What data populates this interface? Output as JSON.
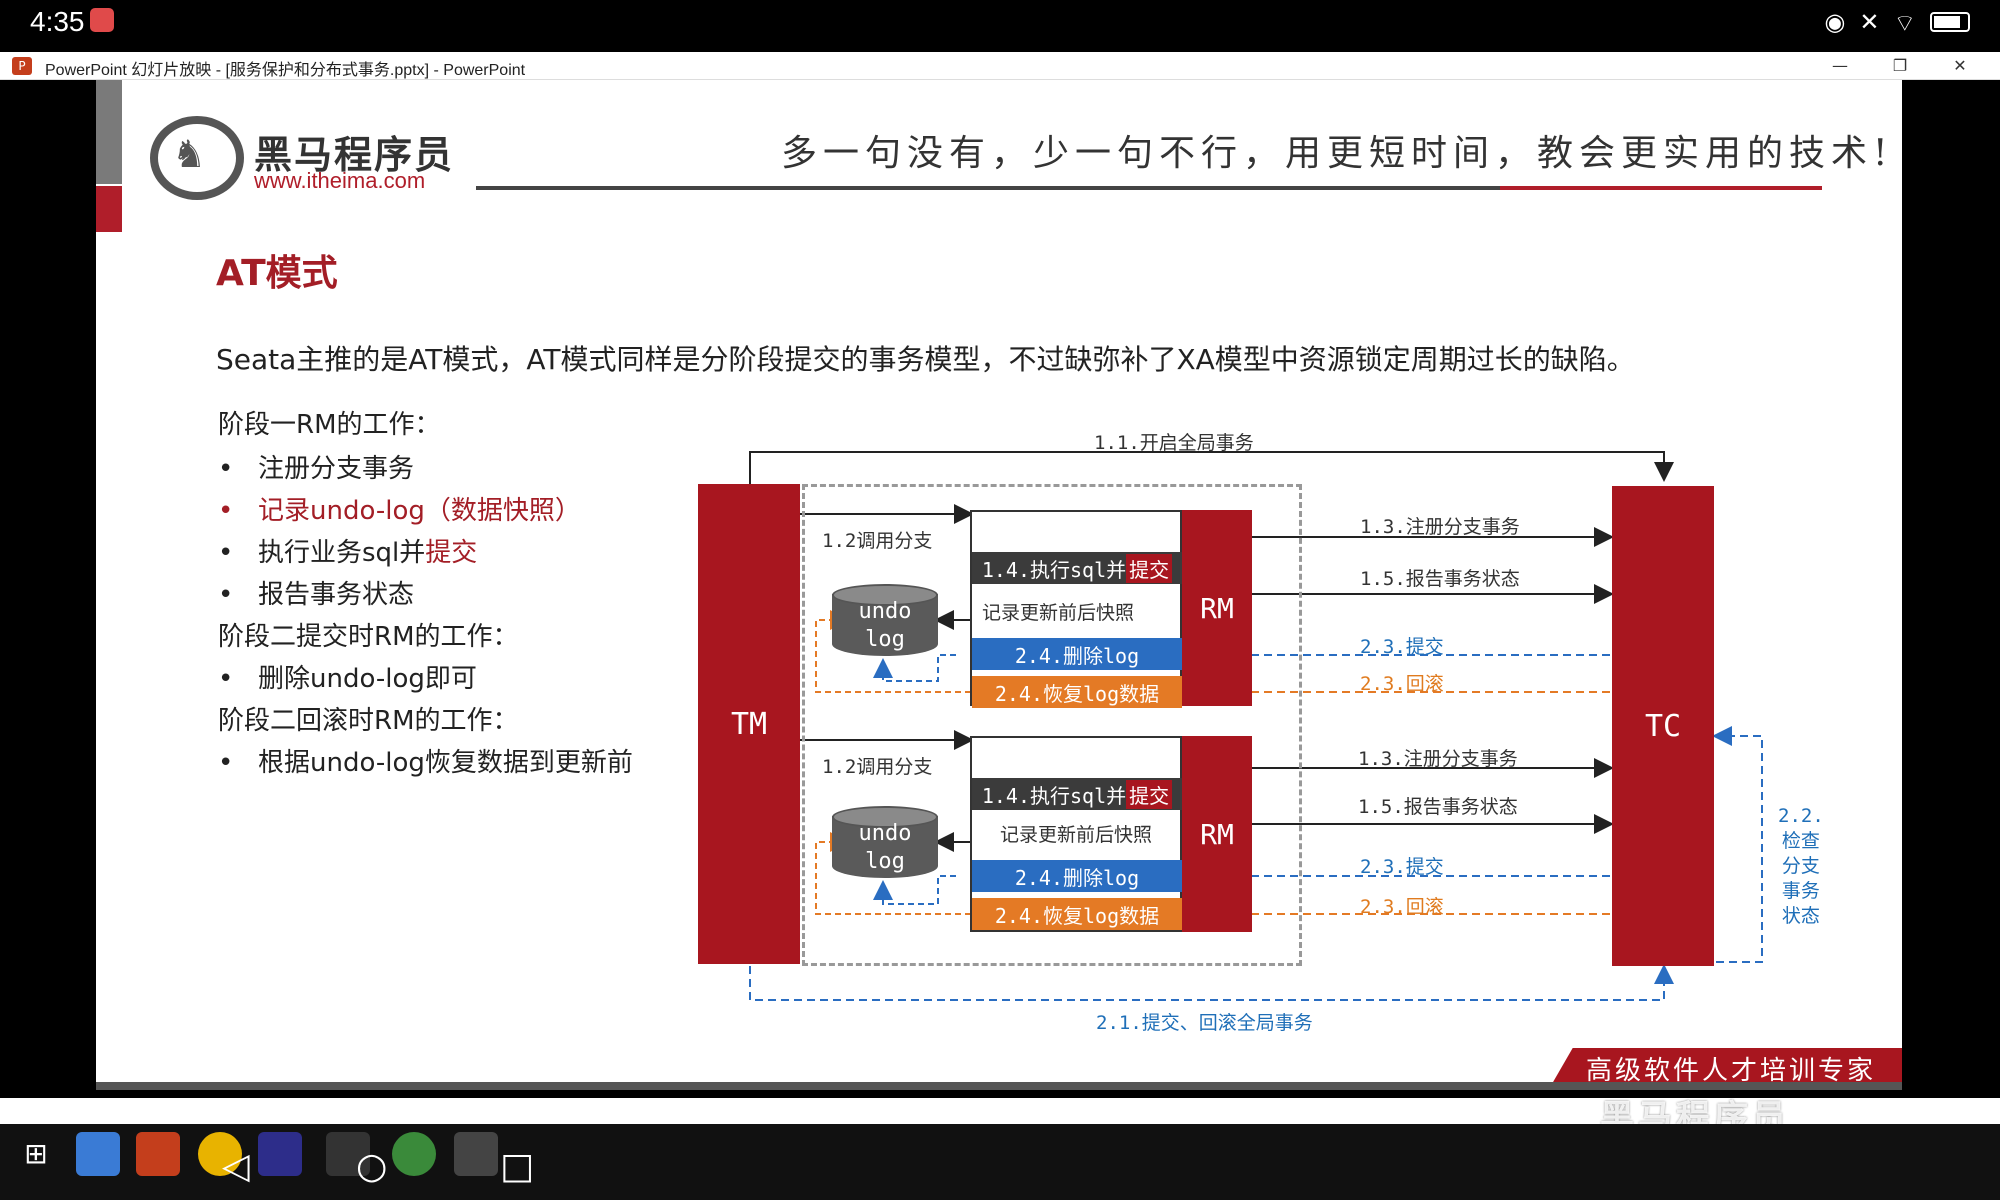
{
  "status_bar": {
    "time": "4:35"
  },
  "window": {
    "title": "PowerPoint 幻灯片放映 - [服务保护和分布式事务.pptx] - PowerPoint",
    "minimize": "—",
    "restore": "❐",
    "close": "✕"
  },
  "slide": {
    "brand_name": "黑马程序员",
    "brand_url": "www.itheima.com",
    "slogan": "多一句没有，少一句不行，用更短时间，教会更实用的技术!",
    "title": "AT模式",
    "intro": "Seata主推的是AT模式，AT模式同样是分阶段提交的事务模型，不过缺弥补了XA模型中资源锁定周期过长的缺陷。",
    "phase1_heading": "阶段一RM的工作：",
    "phase1_items": [
      "注册分支事务",
      "记录undo-log（数据快照）",
      "执行业务sql并",
      "报告事务状态"
    ],
    "phase1_item3_suffix": "提交",
    "phase2_commit_heading": "阶段二提交时RM的工作：",
    "phase2_commit_items": [
      "删除undo-log即可"
    ],
    "phase2_rollback_heading": "阶段二回滚时RM的工作：",
    "phase2_rollback_items": [
      "根据undo-log恢复数据到更新前"
    ],
    "footer_ribbon": "高级软件人才培训专家"
  },
  "diagram": {
    "tm": "TM",
    "tc": "TC",
    "rm": "RM",
    "begin_global": "1.1.开启全局事务",
    "call_branch": "1.2调用分支",
    "exec_sql_prefix": "1.4.执行sql并",
    "exec_sql_suffix": "提交",
    "snapshot": "记录更新前后快照",
    "delete_log": "2.4.删除log",
    "restore_log": "2.4.恢复log数据",
    "register_branch": "1.3.注册分支事务",
    "report_status": "1.5.报告事务状态",
    "commit": "2.3.提交",
    "rollback": "2.3.回滚",
    "undo_log": [
      "undo",
      "log"
    ],
    "check_branch": [
      "2.2.",
      "检查",
      "分支",
      "事务",
      "状态"
    ],
    "global_commit_rollback": "2.1.提交、回滚全局事务"
  },
  "watermark": "黑马程序员",
  "colors": {
    "brand_red": "#a8161f",
    "blue": "#2a6dc1",
    "orange": "#e47a25"
  }
}
